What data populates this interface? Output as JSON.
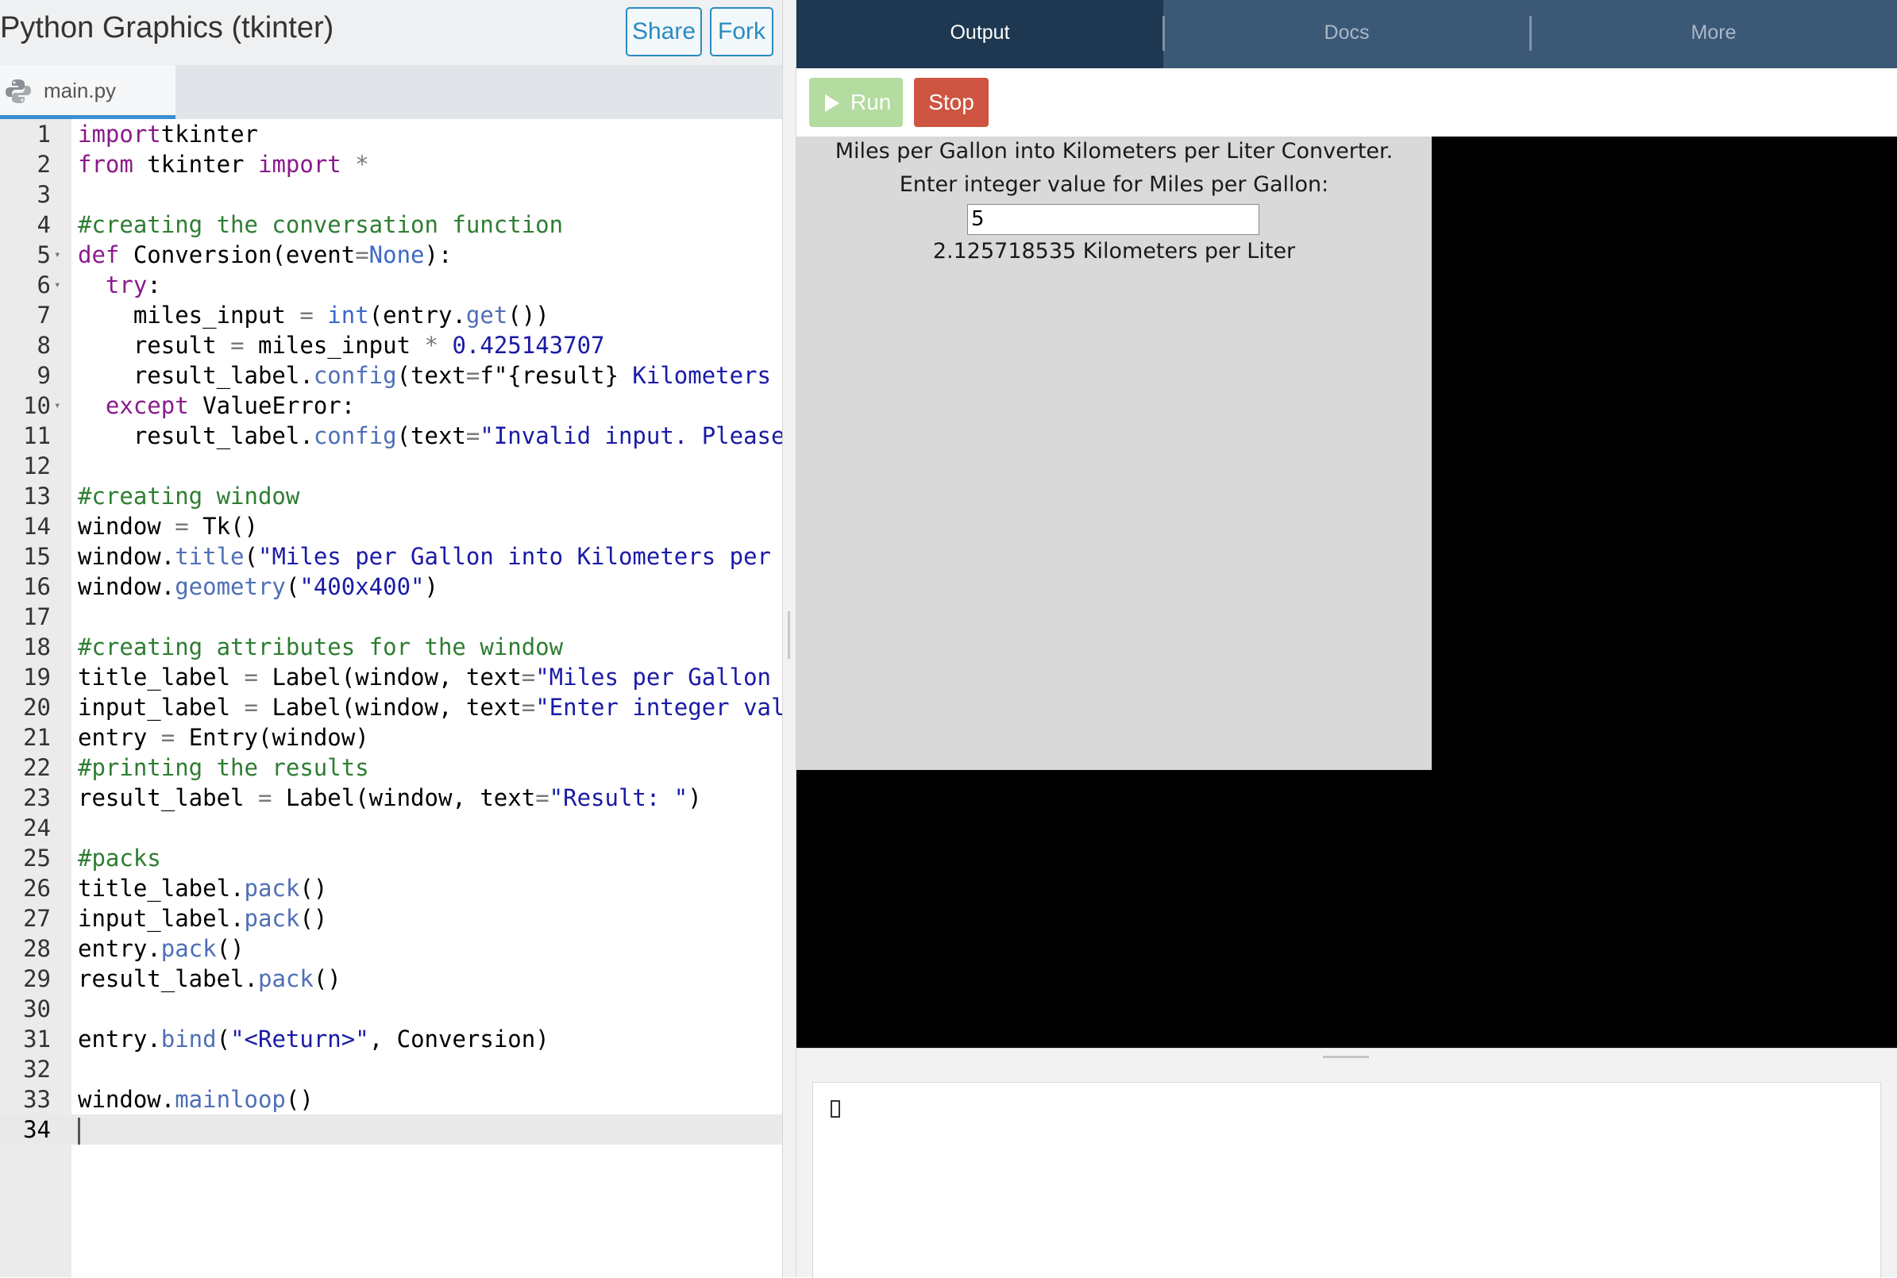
{
  "header": {
    "title": "Python Graphics (tkinter)",
    "share_label": "Share",
    "fork_label": "Fork"
  },
  "editor": {
    "file_tab": "main.py",
    "file_icon": "python-icon",
    "lines": [
      {
        "n": "1",
        "fold": false,
        "tokens": [
          [
            "kw",
            "import"
          ],
          [
            "",
            "tkinter"
          ]
        ]
      },
      {
        "n": "2",
        "fold": false,
        "tokens": [
          [
            "kw",
            "from"
          ],
          [
            "",
            " tkinter "
          ],
          [
            "kw",
            "import"
          ],
          [
            "",
            " "
          ],
          [
            "op",
            "*"
          ]
        ]
      },
      {
        "n": "3",
        "fold": false,
        "tokens": []
      },
      {
        "n": "4",
        "fold": false,
        "tokens": [
          [
            "cm",
            "#creating the conversation function"
          ]
        ]
      },
      {
        "n": "5",
        "fold": true,
        "tokens": [
          [
            "kw",
            "def"
          ],
          [
            "",
            " Conversion(event"
          ],
          [
            "op",
            "="
          ],
          [
            "bi",
            "None"
          ],
          [
            "",
            "):"
          ]
        ]
      },
      {
        "n": "6",
        "fold": true,
        "tokens": [
          [
            "",
            "  "
          ],
          [
            "kw",
            "try"
          ],
          [
            "",
            ":"
          ]
        ]
      },
      {
        "n": "7",
        "fold": false,
        "tokens": [
          [
            "",
            "    miles_input "
          ],
          [
            "op",
            "="
          ],
          [
            "",
            " "
          ],
          [
            "bi",
            "int"
          ],
          [
            "",
            "(entry."
          ],
          [
            "mt",
            "get"
          ],
          [
            "",
            "())"
          ]
        ]
      },
      {
        "n": "8",
        "fold": false,
        "tokens": [
          [
            "",
            "    result "
          ],
          [
            "op",
            "="
          ],
          [
            "",
            " miles_input "
          ],
          [
            "op",
            "*"
          ],
          [
            "",
            " "
          ],
          [
            "num",
            "0.425143707"
          ]
        ]
      },
      {
        "n": "9",
        "fold": false,
        "tokens": [
          [
            "",
            "    result_label."
          ],
          [
            "mt",
            "config"
          ],
          [
            "",
            "(text"
          ],
          [
            "op",
            "="
          ],
          [
            "",
            "f\"{result} "
          ],
          [
            "str",
            "Kilometers pe"
          ]
        ]
      },
      {
        "n": "10",
        "fold": true,
        "tokens": [
          [
            "",
            "  "
          ],
          [
            "kw",
            "except"
          ],
          [
            "",
            " ValueError:"
          ]
        ]
      },
      {
        "n": "11",
        "fold": false,
        "tokens": [
          [
            "",
            "    result_label."
          ],
          [
            "mt",
            "config"
          ],
          [
            "",
            "(text"
          ],
          [
            "op",
            "="
          ],
          [
            "str",
            "\"Invalid input. Please e"
          ]
        ]
      },
      {
        "n": "12",
        "fold": false,
        "tokens": []
      },
      {
        "n": "13",
        "fold": false,
        "tokens": [
          [
            "cm",
            "#creating window"
          ]
        ]
      },
      {
        "n": "14",
        "fold": false,
        "tokens": [
          [
            "",
            "window "
          ],
          [
            "op",
            "="
          ],
          [
            "",
            " Tk()"
          ]
        ]
      },
      {
        "n": "15",
        "fold": false,
        "tokens": [
          [
            "",
            "window."
          ],
          [
            "mt",
            "title"
          ],
          [
            "",
            "("
          ],
          [
            "str",
            "\"Miles per Gallon into Kilometers per Li"
          ]
        ]
      },
      {
        "n": "16",
        "fold": false,
        "tokens": [
          [
            "",
            "window."
          ],
          [
            "mt",
            "geometry"
          ],
          [
            "",
            "("
          ],
          [
            "str",
            "\"400x400\""
          ],
          [
            "",
            ")"
          ]
        ]
      },
      {
        "n": "17",
        "fold": false,
        "tokens": []
      },
      {
        "n": "18",
        "fold": false,
        "tokens": [
          [
            "cm",
            "#creating attributes for the window"
          ]
        ]
      },
      {
        "n": "19",
        "fold": false,
        "tokens": [
          [
            "",
            "title_label "
          ],
          [
            "op",
            "="
          ],
          [
            "",
            " Label(window, text"
          ],
          [
            "op",
            "="
          ],
          [
            "str",
            "\"Miles per Gallon ir"
          ]
        ]
      },
      {
        "n": "20",
        "fold": false,
        "tokens": [
          [
            "",
            "input_label "
          ],
          [
            "op",
            "="
          ],
          [
            "",
            " Label(window, text"
          ],
          [
            "op",
            "="
          ],
          [
            "str",
            "\"Enter integer value"
          ]
        ]
      },
      {
        "n": "21",
        "fold": false,
        "tokens": [
          [
            "",
            "entry "
          ],
          [
            "op",
            "="
          ],
          [
            "",
            " Entry(window)"
          ]
        ]
      },
      {
        "n": "22",
        "fold": false,
        "tokens": [
          [
            "cm",
            "#printing the results"
          ]
        ]
      },
      {
        "n": "23",
        "fold": false,
        "tokens": [
          [
            "",
            "result_label "
          ],
          [
            "op",
            "="
          ],
          [
            "",
            " Label(window, text"
          ],
          [
            "op",
            "="
          ],
          [
            "str",
            "\"Result: \""
          ],
          [
            "",
            ")"
          ]
        ]
      },
      {
        "n": "24",
        "fold": false,
        "tokens": []
      },
      {
        "n": "25",
        "fold": false,
        "tokens": [
          [
            "cm",
            "#packs"
          ]
        ]
      },
      {
        "n": "26",
        "fold": false,
        "tokens": [
          [
            "",
            "title_label."
          ],
          [
            "mt",
            "pack"
          ],
          [
            "",
            "()"
          ]
        ]
      },
      {
        "n": "27",
        "fold": false,
        "tokens": [
          [
            "",
            "input_label."
          ],
          [
            "mt",
            "pack"
          ],
          [
            "",
            "()"
          ]
        ]
      },
      {
        "n": "28",
        "fold": false,
        "tokens": [
          [
            "",
            "entry."
          ],
          [
            "mt",
            "pack"
          ],
          [
            "",
            "()"
          ]
        ]
      },
      {
        "n": "29",
        "fold": false,
        "tokens": [
          [
            "",
            "result_label."
          ],
          [
            "mt",
            "pack"
          ],
          [
            "",
            "()"
          ]
        ]
      },
      {
        "n": "30",
        "fold": false,
        "tokens": []
      },
      {
        "n": "31",
        "fold": false,
        "tokens": [
          [
            "",
            "entry."
          ],
          [
            "mt",
            "bind"
          ],
          [
            "",
            "("
          ],
          [
            "str",
            "\"<Return>\""
          ],
          [
            "",
            ", Conversion)"
          ]
        ]
      },
      {
        "n": "32",
        "fold": false,
        "tokens": []
      },
      {
        "n": "33",
        "fold": false,
        "tokens": [
          [
            "",
            "window."
          ],
          [
            "mt",
            "mainloop"
          ],
          [
            "",
            "()"
          ]
        ]
      },
      {
        "n": "34",
        "fold": false,
        "active": true,
        "tokens": []
      }
    ]
  },
  "right_tabs": {
    "output": "Output",
    "docs": "Docs",
    "more": "More"
  },
  "controls": {
    "run_label": "Run",
    "stop_label": "Stop"
  },
  "tk_app": {
    "title_text": "Miles per Gallon into Kilometers per Liter Converter.",
    "prompt_text": "Enter integer value for Miles per Gallon:",
    "entry_value": "5",
    "result_text": "2.125718535 Kilometers per Liter"
  },
  "colors": {
    "right_tab_bar": "#3b5877",
    "active_tab": "#1d3850",
    "run_button": "#b4dba0",
    "stop_button": "#cd5542",
    "accent": "#2a8bc1"
  }
}
